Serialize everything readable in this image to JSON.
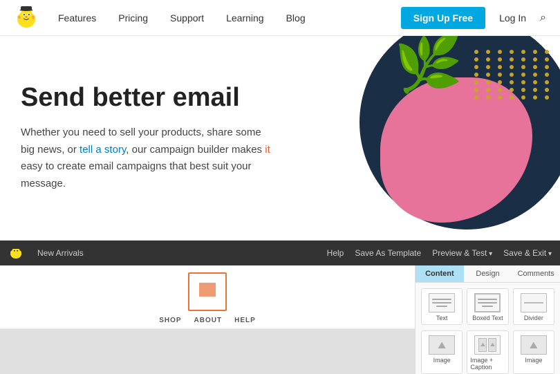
{
  "navbar": {
    "logo_alt": "Mailchimp",
    "links": [
      {
        "label": "Features",
        "id": "features"
      },
      {
        "label": "Pricing",
        "id": "pricing"
      },
      {
        "label": "Support",
        "id": "support"
      },
      {
        "label": "Learning",
        "id": "learning"
      },
      {
        "label": "Blog",
        "id": "blog"
      }
    ],
    "signup_label": "Sign Up Free",
    "login_label": "Log In"
  },
  "hero": {
    "title": "Send better email",
    "description_parts": [
      {
        "text": "Whether you need to sell your products, share some\nbig news, or "
      },
      {
        "text": "tell a story",
        "class": "highlight-blue"
      },
      {
        "text": ", our campaign builder makes "
      },
      {
        "text": "it",
        "class": "highlight-red"
      },
      {
        "text": "\neasy to create email campaigns that best suit your\nmessage."
      }
    ]
  },
  "builder": {
    "toolbar": {
      "new_arrivals": "New Arrivals",
      "actions": [
        {
          "label": "Help"
        },
        {
          "label": "Save As Template"
        },
        {
          "label": "Preview & Test",
          "arrow": true
        },
        {
          "label": "Save & Exit",
          "arrow": true
        }
      ]
    },
    "canvas": {
      "nav_items": [
        "SHOP",
        "ABOUT",
        "HELP"
      ]
    },
    "right_panel": {
      "tabs": [
        {
          "label": "Content",
          "active": true
        },
        {
          "label": "Design",
          "active": false
        },
        {
          "label": "Comments",
          "active": false
        }
      ],
      "blocks": [
        {
          "label": "Text",
          "type": "text"
        },
        {
          "label": "Boxed Text",
          "type": "boxed-text"
        },
        {
          "label": "Divider",
          "type": "divider"
        },
        {
          "label": "Image",
          "type": "image"
        },
        {
          "label": "Image + Caption",
          "type": "image-caption"
        },
        {
          "label": "Image",
          "type": "image2"
        }
      ]
    }
  }
}
